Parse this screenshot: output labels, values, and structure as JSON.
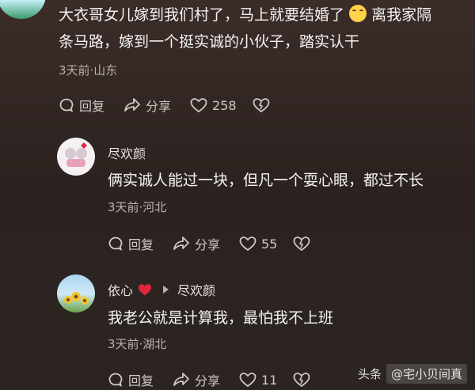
{
  "comments": [
    {
      "text_line1": "大衣哥女儿嫁到我们村了，马上就要结婚了",
      "text_line1_after": "离我家隔",
      "text_line2": "条马路，嫁到一个挺实诚的小伙子，踏实认干",
      "meta": "3天前·山东",
      "reply_label": "回复",
      "share_label": "分享",
      "likes": "258"
    },
    {
      "author": "尽欢颜",
      "text": "俩实诚人能过一块，但凡一个耍心眼，都过不长",
      "meta": "3天前·河北",
      "reply_label": "回复",
      "share_label": "分享",
      "likes": "55"
    },
    {
      "author": "依心",
      "reply_to": "尽欢颜",
      "text": "我老公就是计算我，最怕我不上班",
      "meta": "3天前·湖北",
      "reply_label": "回复",
      "share_label": "分享",
      "likes": "11"
    }
  ],
  "watermark": {
    "left": "头条",
    "right": "@宅小贝间真"
  },
  "colors": {
    "heart": "#e0263a",
    "emoji": "#ffd34a"
  },
  "icons": [
    "reply-icon",
    "share-icon",
    "heart-outline-icon",
    "broken-heart-icon",
    "triangle-right-icon",
    "heart-icon"
  ]
}
